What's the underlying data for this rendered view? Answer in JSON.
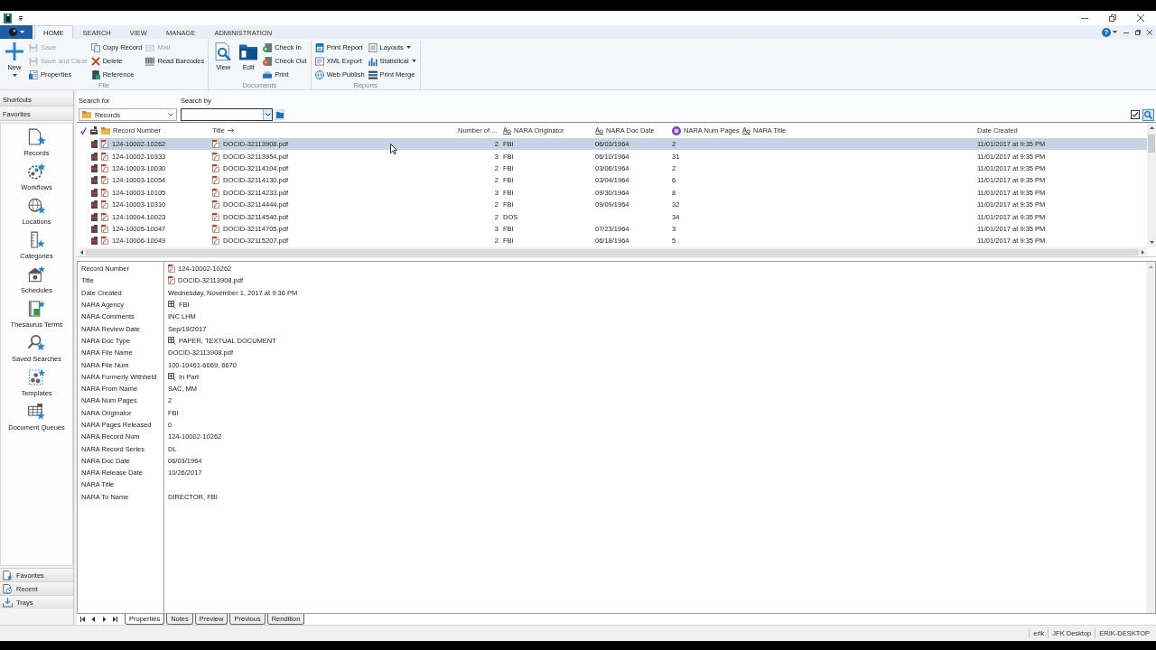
{
  "ribbon": {
    "tabs": [
      {
        "label": "HOME",
        "selected": true
      },
      {
        "label": "SEARCH",
        "selected": false
      },
      {
        "label": "VIEW",
        "selected": false
      },
      {
        "label": "MANAGE",
        "selected": false
      },
      {
        "label": "ADMINISTRATION",
        "selected": false
      }
    ],
    "help": "?",
    "groups": [
      {
        "title": "File",
        "buttons": [
          {
            "label": "New",
            "kind": "large",
            "disabled": false,
            "dropdown": true
          },
          {
            "label": "Save",
            "kind": "small",
            "disabled": true,
            "dropdown": false
          },
          {
            "label": "Save and Clear",
            "kind": "small",
            "disabled": true,
            "dropdown": false
          },
          {
            "label": "Properties",
            "kind": "small",
            "disabled": false,
            "dropdown": false
          },
          {
            "label": "Copy Record",
            "kind": "small",
            "disabled": false,
            "dropdown": false
          },
          {
            "label": "Delete",
            "kind": "small",
            "disabled": false,
            "dropdown": false
          },
          {
            "label": "Reference",
            "kind": "small",
            "disabled": false,
            "dropdown": false
          },
          {
            "label": "Mail",
            "kind": "small",
            "disabled": true,
            "dropdown": false
          },
          {
            "label": "Read Barcodes",
            "kind": "small",
            "disabled": false,
            "dropdown": false
          }
        ]
      },
      {
        "title": "Documents",
        "buttons": [
          {
            "label": "View",
            "kind": "large",
            "disabled": false,
            "dropdown": false
          },
          {
            "label": "Edit",
            "kind": "large",
            "disabled": false,
            "dropdown": false
          },
          {
            "label": "Check In",
            "kind": "small",
            "disabled": false,
            "dropdown": false
          },
          {
            "label": "Check Out",
            "kind": "small",
            "disabled": false,
            "dropdown": false
          },
          {
            "label": "Print",
            "kind": "small",
            "disabled": false,
            "dropdown": false
          }
        ]
      },
      {
        "title": "Reports",
        "buttons": [
          {
            "label": "Print Report",
            "kind": "small",
            "disabled": false,
            "dropdown": false
          },
          {
            "label": "XML Export",
            "kind": "small",
            "disabled": false,
            "dropdown": false
          },
          {
            "label": "Web Publish",
            "kind": "small",
            "disabled": false,
            "dropdown": false
          },
          {
            "label": "Layouts",
            "kind": "small",
            "disabled": false,
            "dropdown": true
          },
          {
            "label": "Statistical",
            "kind": "small",
            "disabled": false,
            "dropdown": true
          },
          {
            "label": "Print Merge",
            "kind": "small",
            "disabled": false,
            "dropdown": false
          }
        ]
      }
    ]
  },
  "sidebar": {
    "headers": [
      "Shortcuts",
      "Favorites"
    ],
    "items": [
      "Records",
      "Workflows",
      "Locations",
      "Categories",
      "Schedules",
      "Thesaurus Terms",
      "Saved Searches",
      "Templates",
      "Document Queues"
    ],
    "panes": [
      "Favorites",
      "Recent",
      "Trays"
    ]
  },
  "search": {
    "search_for": {
      "label": "Search for",
      "value": "Records"
    },
    "search_by": {
      "label": "Search by"
    }
  },
  "grid": {
    "columns": [
      {
        "label": "Record Number",
        "kind": "record",
        "sorted": false
      },
      {
        "label": "Title",
        "kind": "document",
        "sorted": true
      },
      {
        "label": "Number of …",
        "kind": "count",
        "sorted": false
      },
      {
        "label": "NARA Originator",
        "kind": "text-field",
        "sorted": false
      },
      {
        "label": "NARA Doc Date",
        "kind": "text-field",
        "sorted": false
      },
      {
        "label": "NARA Num Pages",
        "kind": "number-field",
        "sorted": false
      },
      {
        "label": "NARA Title",
        "kind": "text-field",
        "sorted": false
      },
      {
        "label": "Date Created",
        "kind": "plain",
        "sorted": false
      }
    ],
    "rows": [
      {
        "selected": true,
        "record_number": "124-10002-10262",
        "title": "DOCID-32113908.pdf",
        "number_of": "2",
        "nara_originator": "FBI",
        "nara_doc_date": "06/03/1964",
        "nara_num_pages": "2",
        "date_created": "11/01/2017 at 9:35 PM"
      },
      {
        "selected": false,
        "record_number": "124-10002-10333",
        "title": "DOCID-32113954.pdf",
        "number_of": "3",
        "nara_originator": "FBI",
        "nara_doc_date": "06/10/1964",
        "nara_num_pages": "31",
        "date_created": "11/01/2017 at 9:35 PM"
      },
      {
        "selected": false,
        "record_number": "124-10003-10030",
        "title": "DOCID-32114104.pdf",
        "number_of": "2",
        "nara_originator": "FBI",
        "nara_doc_date": "03/06/1964",
        "nara_num_pages": "2",
        "date_created": "11/01/2017 at 9:35 PM"
      },
      {
        "selected": false,
        "record_number": "124-10003-10054",
        "title": "DOCID-32114130.pdf",
        "number_of": "2",
        "nara_originator": "FBI",
        "nara_doc_date": "03/04/1964",
        "nara_num_pages": "6",
        "date_created": "11/01/2017 at 9:35 PM"
      },
      {
        "selected": false,
        "record_number": "124-10003-10105",
        "title": "DOCID-32114233.pdf",
        "number_of": "3",
        "nara_originator": "FBI",
        "nara_doc_date": "09/30/1964",
        "nara_num_pages": "8",
        "date_created": "11/01/2017 at 9:35 PM"
      },
      {
        "selected": false,
        "record_number": "124-10003-10310",
        "title": "DOCID-32114444.pdf",
        "number_of": "2",
        "nara_originator": "FBI",
        "nara_doc_date": "09/09/1964",
        "nara_num_pages": "32",
        "date_created": "11/01/2017 at 9:35 PM"
      },
      {
        "selected": false,
        "record_number": "124-10004-10023",
        "title": "DOCID-32114540.pdf",
        "number_of": "2",
        "nara_originator": "DOS",
        "nara_num_pages": "34",
        "date_created": "11/01/2017 at 9:35 PM"
      },
      {
        "selected": false,
        "record_number": "124-10005-10047",
        "title": "DOCID-32114705.pdf",
        "number_of": "3",
        "nara_originator": "FBI",
        "nara_doc_date": "07/23/1964",
        "nara_num_pages": "3",
        "date_created": "11/01/2017 at 9:35 PM"
      },
      {
        "selected": false,
        "record_number": "124-10006-10049",
        "title": "DOCID-32115207.pdf",
        "number_of": "2",
        "nara_originator": "FBI",
        "nara_doc_date": "06/18/1964",
        "nara_num_pages": "5",
        "date_created": "11/01/2017 at 9:35 PM"
      }
    ]
  },
  "properties": [
    {
      "label": "Record Number",
      "value": "124-10002-10262",
      "kind": "document"
    },
    {
      "label": "Title",
      "value": "DOCID-32113908.pdf",
      "kind": "document"
    },
    {
      "label": "Date Created",
      "value": "Wednesday, November 1, 2017 at 9:36 PM",
      "kind": "text"
    },
    {
      "label": "NARA Agency",
      "value": "FBI",
      "kind": "lookup"
    },
    {
      "label": "NARA Comments",
      "value": "INC LHM",
      "kind": "text"
    },
    {
      "label": "NARA Review Date",
      "value": "Sep/19/2017",
      "kind": "text"
    },
    {
      "label": "NARA Doc Type",
      "value": "PAPER, TEXTUAL DOCUMENT",
      "kind": "lookup"
    },
    {
      "label": "NARA File Name",
      "value": "DOCID-32113908.pdf",
      "kind": "text"
    },
    {
      "label": "NARA File Num",
      "value": "100-10461-6669, 6670",
      "kind": "text"
    },
    {
      "label": "NARA Formerly Withheld",
      "value": "In Part",
      "kind": "lookup"
    },
    {
      "label": "NARA From Name",
      "value": "SAC, MM",
      "kind": "text"
    },
    {
      "label": "NARA Num Pages",
      "value": "2",
      "kind": "text"
    },
    {
      "label": "NARA Originator",
      "value": "FBI",
      "kind": "text"
    },
    {
      "label": "NARA Pages Released",
      "value": "0",
      "kind": "text"
    },
    {
      "label": "NARA Record Num",
      "value": "124-10002-10262",
      "kind": "text"
    },
    {
      "label": "NARA Record Series",
      "value": "DL",
      "kind": "text"
    },
    {
      "label": "NARA Doc Date",
      "value": "06/03/1964",
      "kind": "text"
    },
    {
      "label": "NARA Release Date",
      "value": "10/26/2017",
      "kind": "text"
    },
    {
      "label": "NARA Title",
      "kind": "text"
    },
    {
      "label": "NARA To Name",
      "value": "DIRECTOR, FBI",
      "kind": "text"
    }
  ],
  "document_tabs": [
    {
      "label": "Properties",
      "selected": true
    },
    {
      "label": "Notes",
      "selected": false
    },
    {
      "label": "Preview",
      "selected": false
    },
    {
      "label": "Previous",
      "selected": false
    },
    {
      "label": "Rendition",
      "selected": false
    }
  ],
  "status_bar": [
    "erik",
    "JFK Desktop",
    "ERIK-DESKTOP"
  ]
}
